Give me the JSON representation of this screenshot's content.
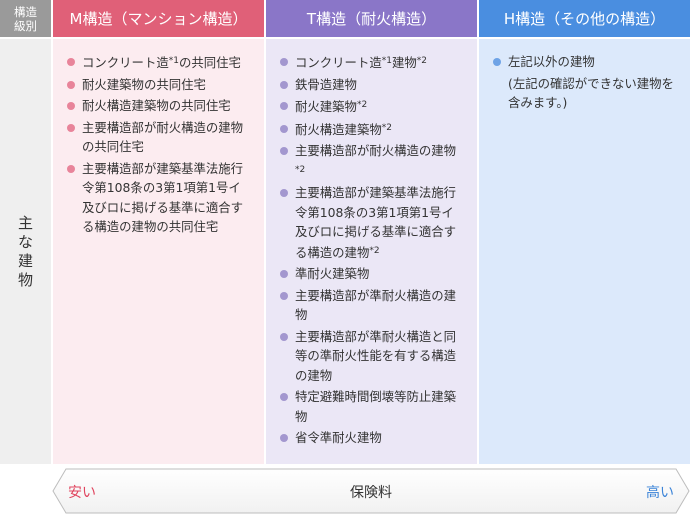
{
  "header": {
    "corner_line1": "構造",
    "corner_line2": "級別",
    "m_title": "M構造（マンション構造）",
    "t_title": "T構造（耐火構造）",
    "h_title": "H構造（その他の構造）"
  },
  "row_label": [
    "主",
    "な",
    "建",
    "物"
  ],
  "columns": {
    "m": {
      "color": "#e06078",
      "items": [
        {
          "text": "コンクリート造",
          "note": "*1",
          "after": "の共同住宅"
        },
        {
          "text": "耐火建築物の共同住宅",
          "note": "",
          "after": ""
        },
        {
          "text": "耐火構造建築物の共同住宅",
          "note": "",
          "after": ""
        },
        {
          "text": "主要構造部が耐火構造の建物の共同住宅",
          "note": "",
          "after": ""
        },
        {
          "text": "主要構造部が建築基準法施行令第108条の3第1項第1号イ及びロに掲げる基準に適合する構造の建物の共同住宅",
          "note": "",
          "after": ""
        }
      ]
    },
    "t": {
      "color": "#8a76c8",
      "items": [
        {
          "text": "コンクリート造",
          "note": "*1",
          "after": "建物",
          "note2": "*2"
        },
        {
          "text": "鉄骨造建物",
          "note": "",
          "after": ""
        },
        {
          "text": "耐火建築物",
          "note": "*2",
          "after": ""
        },
        {
          "text": "耐火構造建築物",
          "note": "*2",
          "after": ""
        },
        {
          "text": "主要構造部が耐火構造の建物",
          "note": "*2",
          "after": ""
        },
        {
          "text": "主要構造部が建築基準法施行令第108条の3第1項第1号イ及びロに掲げる基準に適合する構造の建物",
          "note": "*2",
          "after": ""
        },
        {
          "text": "準耐火建築物",
          "note": "",
          "after": ""
        },
        {
          "text": "主要構造部が準耐火構造の建物",
          "note": "",
          "after": ""
        },
        {
          "text": "主要構造部が準耐火構造と同等の準耐火性能を有する構造の建物",
          "note": "",
          "after": ""
        },
        {
          "text": "特定避難時間倒壊等防止建築物",
          "note": "",
          "after": ""
        },
        {
          "text": "省令準耐火建物",
          "note": "",
          "after": ""
        }
      ]
    },
    "h": {
      "color": "#4a8ee0",
      "items": [
        {
          "text": "左記以外の建物",
          "note": "",
          "after": ""
        },
        {
          "text": "(左記の確認ができない建物を含みます。)",
          "note": "",
          "after": "",
          "nodot": true
        }
      ]
    }
  },
  "scale": {
    "low": "安い",
    "label": "保険料",
    "high": "高い"
  }
}
